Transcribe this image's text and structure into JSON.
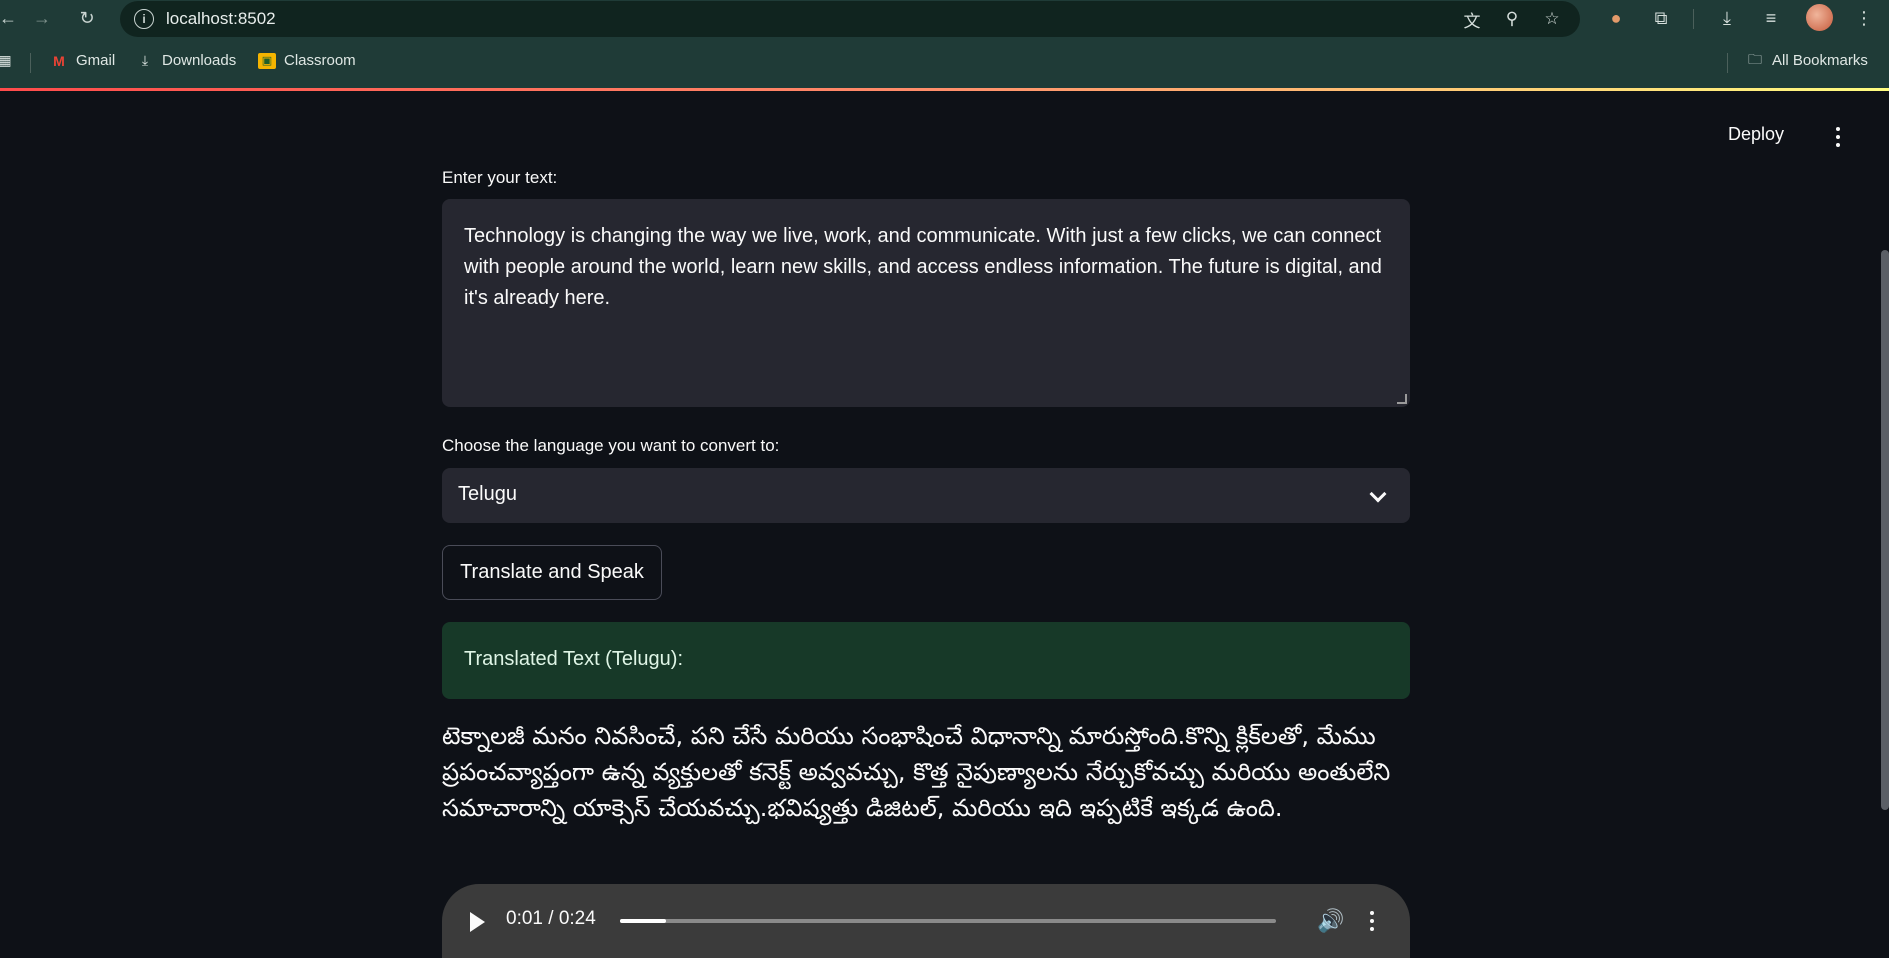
{
  "browser": {
    "url": "localhost:8502",
    "bookmarks": [
      {
        "label": "Gmail"
      },
      {
        "label": "Downloads"
      },
      {
        "label": "Classroom"
      }
    ],
    "all_bookmarks_label": "All Bookmarks"
  },
  "app": {
    "deploy_label": "Deploy",
    "text_label": "Enter your text:",
    "text_value": "Technology is changing the way we live, work, and communicate. With just a few clicks, we can connect with people around the world, learn new skills, and access endless information. The future is digital, and it's already here.",
    "language_label": "Choose the language you want to convert to:",
    "language_value": "Telugu",
    "button_label": "Translate and Speak",
    "result_heading": "Translated Text (Telugu):",
    "translated_text": "టెక్నాలజీ మనం నివసించే, పని చేసే మరియు సంభాషించే విధానాన్ని మారుస్తోంది.కొన్ని క్లిక్‌లతో, మేము ప్రపంచవ్యాప్తంగా ఉన్న వ్యక్తులతో కనెక్ట్ అవ్వవచ్చు, కొత్త నైపుణ్యాలను నేర్చుకోవచ్చు మరియు అంతులేని సమాచారాన్ని యాక్సెస్ చేయవచ్చు.భవిష్యత్తు డిజిటల్, మరియు ఇది ఇప్పటికే ఇక్కడ ఉంది.",
    "audio": {
      "time": "0:01 / 0:24",
      "progress": 0.07
    }
  }
}
